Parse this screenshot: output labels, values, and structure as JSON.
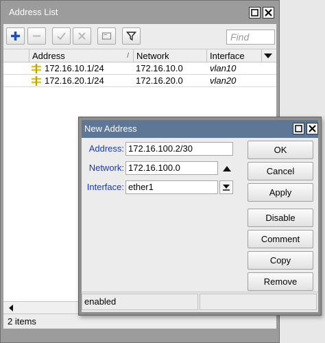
{
  "address_list": {
    "title": "Address List",
    "find_placeholder": "Find",
    "columns": [
      "Address",
      "Network",
      "Interface"
    ],
    "rows": [
      {
        "address": "172.16.10.1/24",
        "network": "172.16.10.0",
        "interface": "vlan10"
      },
      {
        "address": "172.16.20.1/24",
        "network": "172.16.20.0",
        "interface": "vlan20"
      }
    ],
    "status": "2 items"
  },
  "new_address": {
    "title": "New Address",
    "address_label": "Address:",
    "address_value": "172.16.100.2/30",
    "network_label": "Network:",
    "network_value": "172.16.100.0",
    "interface_label": "Interface:",
    "interface_value": "ether1",
    "buttons": {
      "ok": "OK",
      "cancel": "Cancel",
      "apply": "Apply",
      "disable": "Disable",
      "comment": "Comment",
      "copy": "Copy",
      "remove": "Remove"
    },
    "status": "enabled"
  },
  "colors": {
    "title_bar": "#5f7797",
    "label_blue": "#1a3aa8",
    "add_icon": "#1a4fbf",
    "address_icon": "#e0c21a"
  }
}
